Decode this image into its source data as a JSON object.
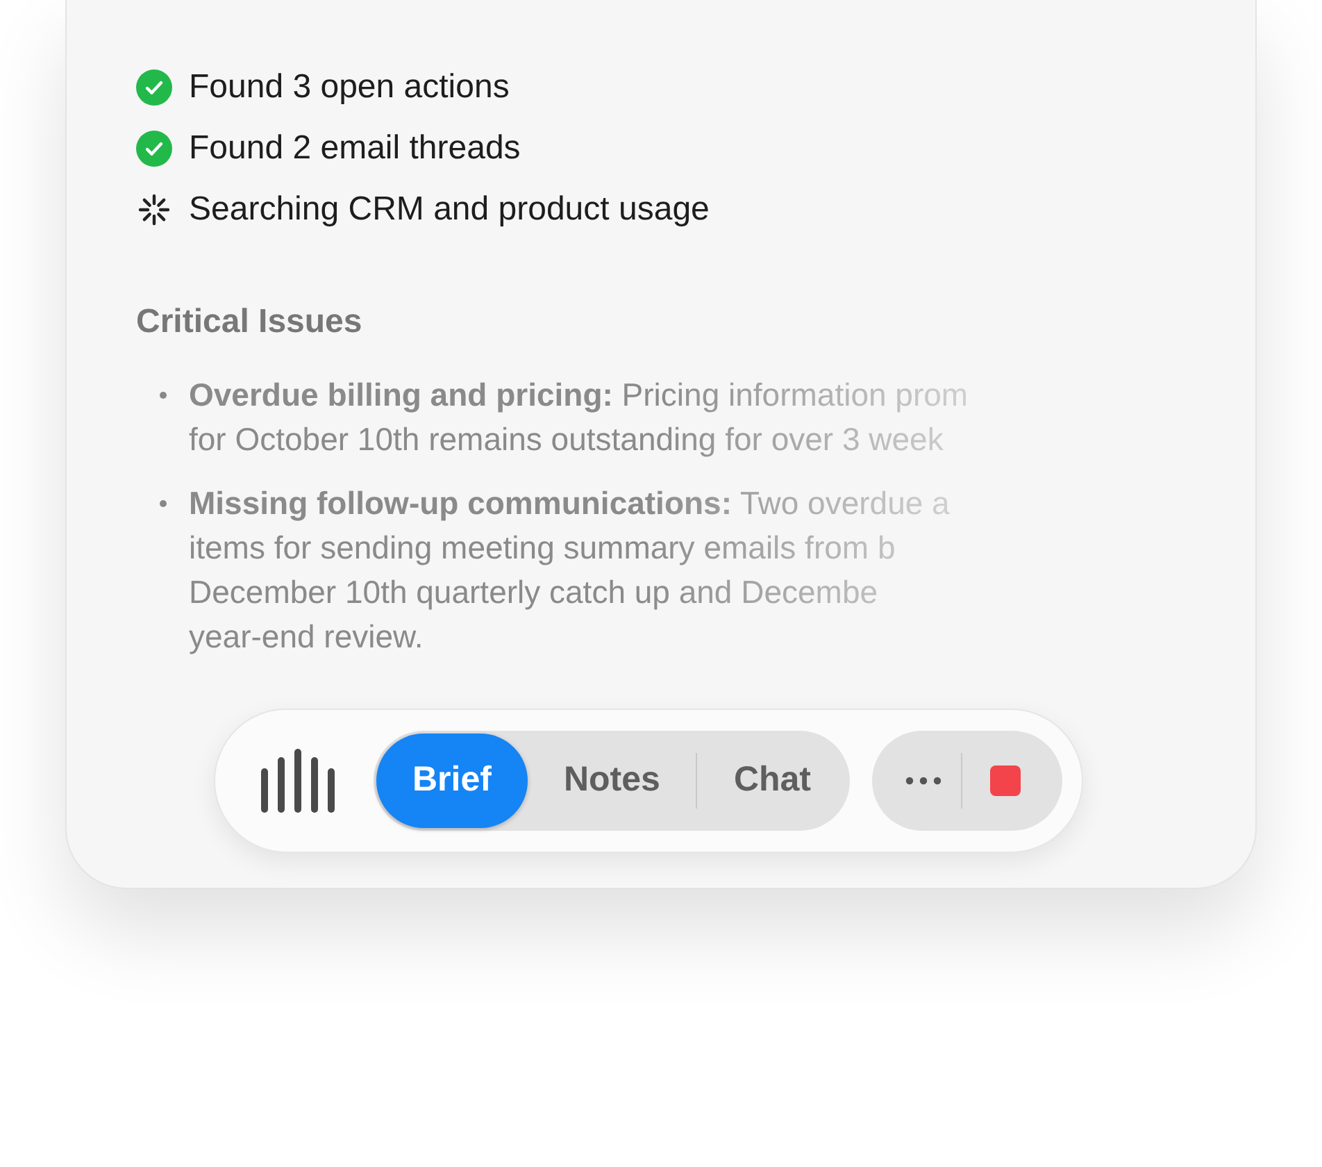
{
  "progress": [
    {
      "kind": "done",
      "text": "Found 3 open actions"
    },
    {
      "kind": "done",
      "text": "Found 2 email threads"
    },
    {
      "kind": "loading",
      "text": "Searching CRM and product usage"
    }
  ],
  "section": {
    "title": "Critical Issues",
    "bullets": [
      {
        "lines": [
          "**Overdue billing and pricing:** Pricing information prom",
          "for October 10th remains outstanding for over 3 week"
        ]
      },
      {
        "lines": [
          "**Missing follow-up communications:** Two overdue a",
          "items for sending meeting summary emails from b",
          "December 10th quarterly catch up and Decembe",
          "year-end review."
        ]
      }
    ]
  },
  "toolbar": {
    "tabs": [
      {
        "label": "Brief",
        "selected": true
      },
      {
        "label": "Notes",
        "selected": false
      },
      {
        "label": "Chat",
        "selected": false
      }
    ]
  }
}
